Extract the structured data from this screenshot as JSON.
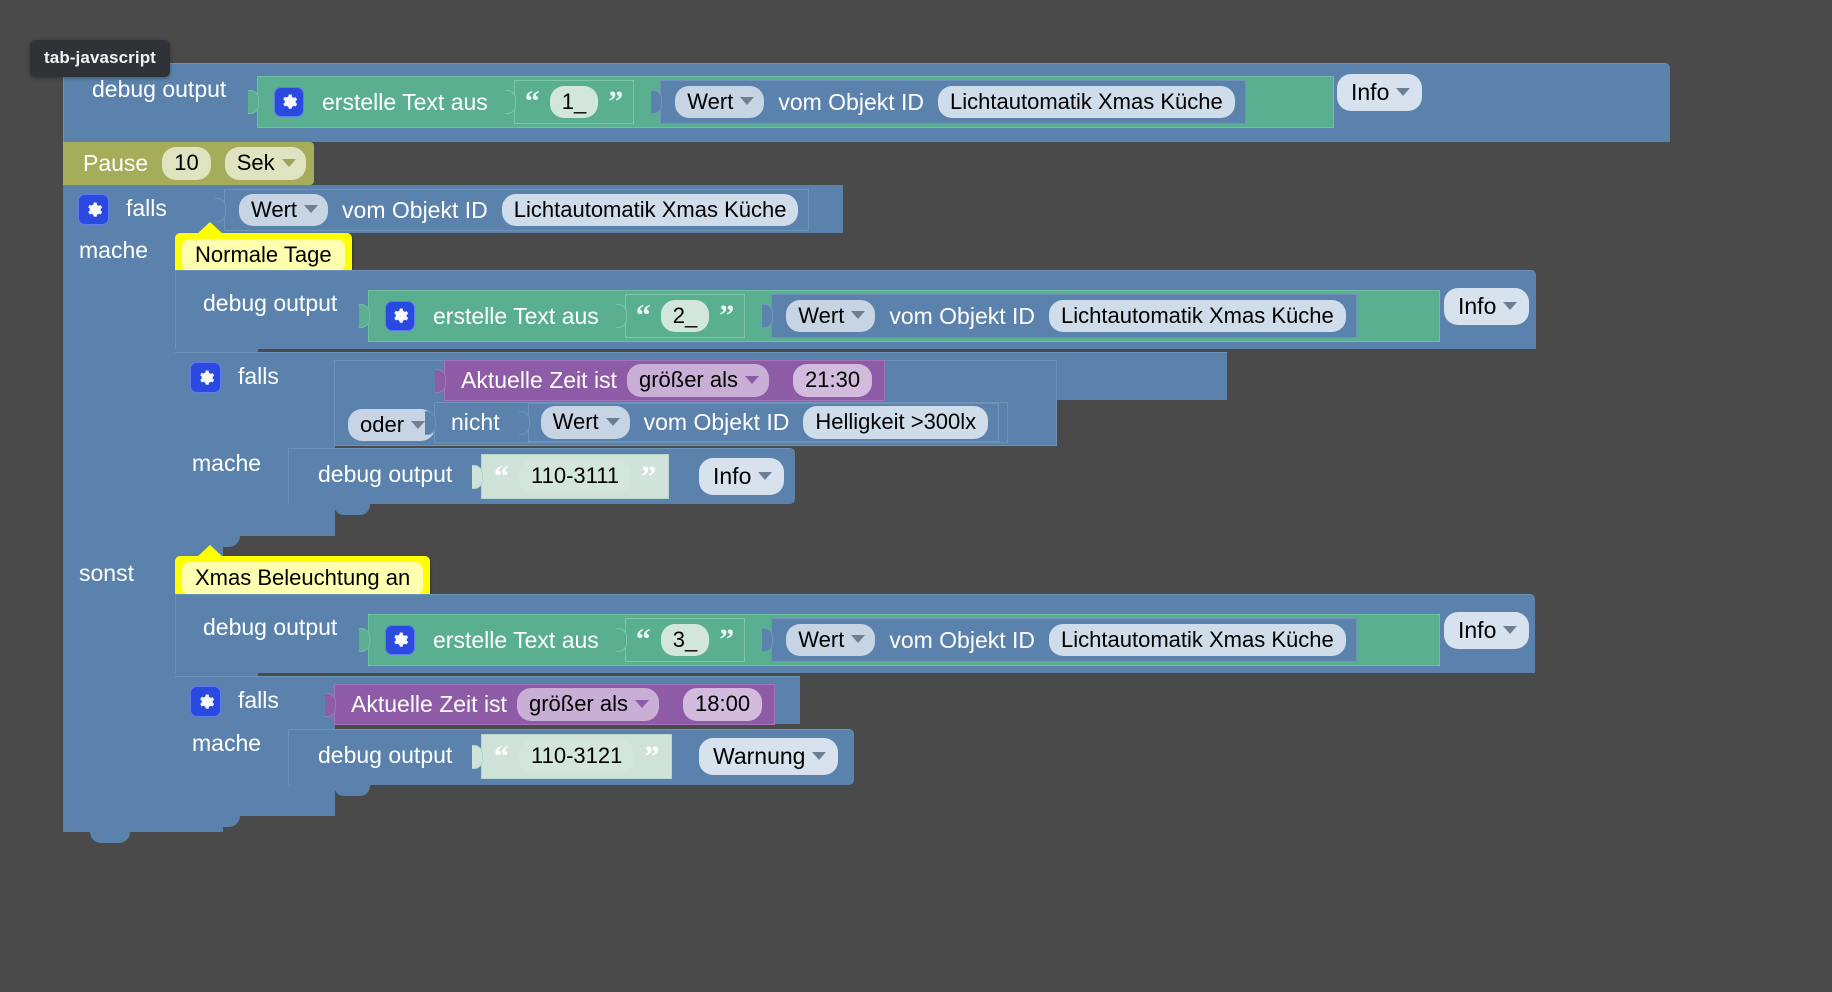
{
  "tooltip": {
    "text": "tab-javascript"
  },
  "palette": {
    "canvas_bg": "#4a4a4a",
    "control_blue": "#5b82ac",
    "text_green": "#5aaf90",
    "timer_olive": "#a5ad5a",
    "time_purple": "#8e5ba6",
    "note_yellow": "#ffff00",
    "gear_blue": "#2a49e0"
  },
  "blocks": {
    "debug1": {
      "label": "debug output",
      "text_builder": "erstelle Text aus",
      "text_value": "1_",
      "getter_kind": "Wert",
      "getter_prefix": "vom Objekt ID",
      "object_id": "Lichtautomatik Xmas Küche",
      "severity": "Info"
    },
    "pause": {
      "label": "Pause",
      "value": "10",
      "unit": "Sek"
    },
    "if_outer": {
      "label": "falls",
      "do_label": "mache",
      "else_label": "sonst",
      "getter_kind": "Wert",
      "getter_prefix": "vom Objekt ID",
      "object_id": "Lichtautomatik Xmas Küche"
    },
    "note_do": {
      "text": "Normale Tage"
    },
    "note_else": {
      "text": "Xmas Beleuchtung an"
    },
    "debug2": {
      "label": "debug output",
      "text_builder": "erstelle Text aus",
      "text_value": "2_",
      "getter_kind": "Wert",
      "getter_prefix": "vom Objekt ID",
      "object_id": "Lichtautomatik Xmas Küche",
      "severity": "Info"
    },
    "if_inner_a": {
      "label": "falls",
      "do_label": "mache",
      "operator": "oder",
      "not_label": "nicht",
      "time_label": "Aktuelle Zeit ist",
      "time_comparator": "größer als",
      "time_value": "21:30",
      "getter_kind": "Wert",
      "getter_prefix": "vom Objekt ID",
      "object_id": "Helligkeit >300lx"
    },
    "debug3": {
      "label": "debug output",
      "text_value": "110-3111",
      "severity": "Info"
    },
    "debug4": {
      "label": "debug output",
      "text_builder": "erstelle Text aus",
      "text_value": "3_",
      "getter_kind": "Wert",
      "getter_prefix": "vom Objekt ID",
      "object_id": "Lichtautomatik Xmas Küche",
      "severity": "Info"
    },
    "if_inner_b": {
      "label": "falls",
      "do_label": "mache",
      "time_label": "Aktuelle Zeit ist",
      "time_comparator": "größer als",
      "time_value": "18:00"
    },
    "debug5": {
      "label": "debug output",
      "text_value": "110-3121",
      "severity": "Warnung"
    }
  }
}
